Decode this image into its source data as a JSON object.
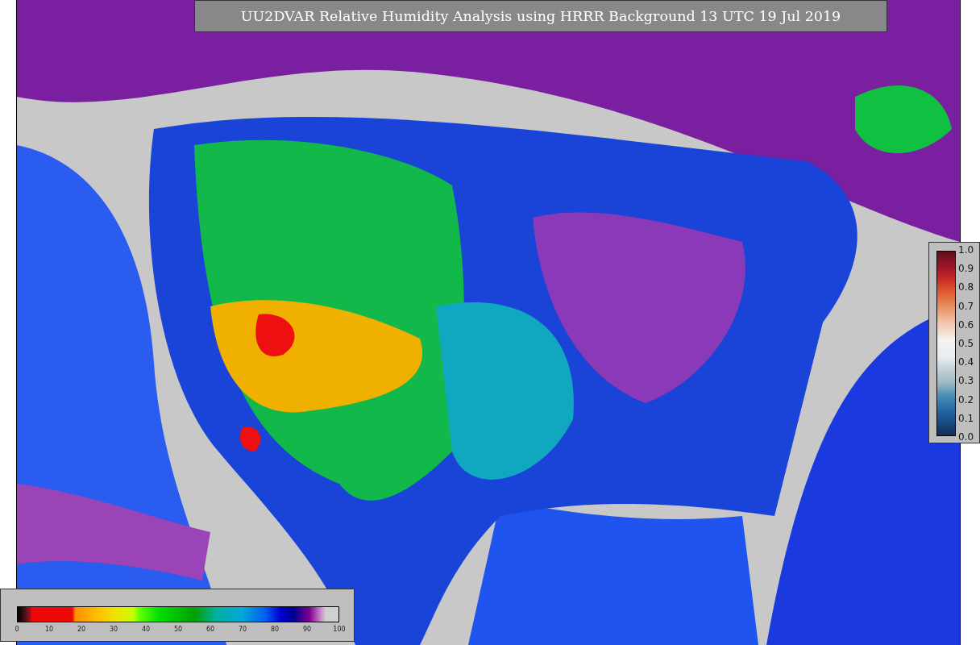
{
  "title": "UU2DVAR Relative Humidity Analysis using HRRR Background 13 UTC 19 Jul 2019",
  "humidity_colorbar": {
    "ticks": [
      "0",
      "10",
      "20",
      "30",
      "40",
      "50",
      "60",
      "70",
      "80",
      "90",
      "100"
    ]
  },
  "observation_colorbar": {
    "ticks": [
      "1.0",
      "0.9",
      "0.8",
      "0.7",
      "0.6",
      "0.5",
      "0.4",
      "0.3",
      "0.2",
      "0.1",
      "0.0"
    ]
  }
}
